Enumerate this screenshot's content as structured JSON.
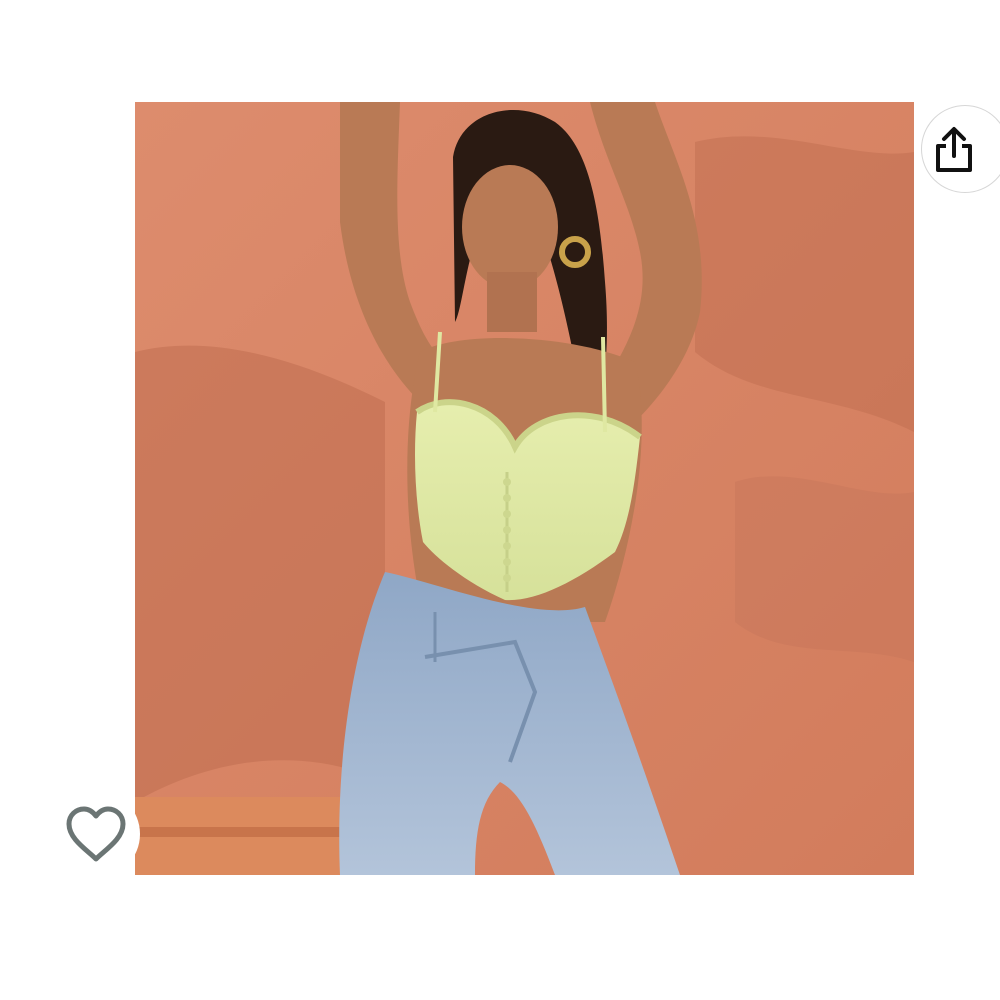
{
  "colors": {
    "background": "#ffffff",
    "wall": "#d98566",
    "wall_shadow": "#b8674c",
    "top_garment": "#dfe8a2",
    "denim": "#9fb4cf",
    "skin": "#b97a55",
    "hair": "#2a1a12",
    "icon_share": "#111111",
    "icon_heart": "#6b7574"
  },
  "icons": {
    "share": "share-icon",
    "wishlist": "heart-outline-icon"
  },
  "image": {
    "subject": "product-photo"
  }
}
